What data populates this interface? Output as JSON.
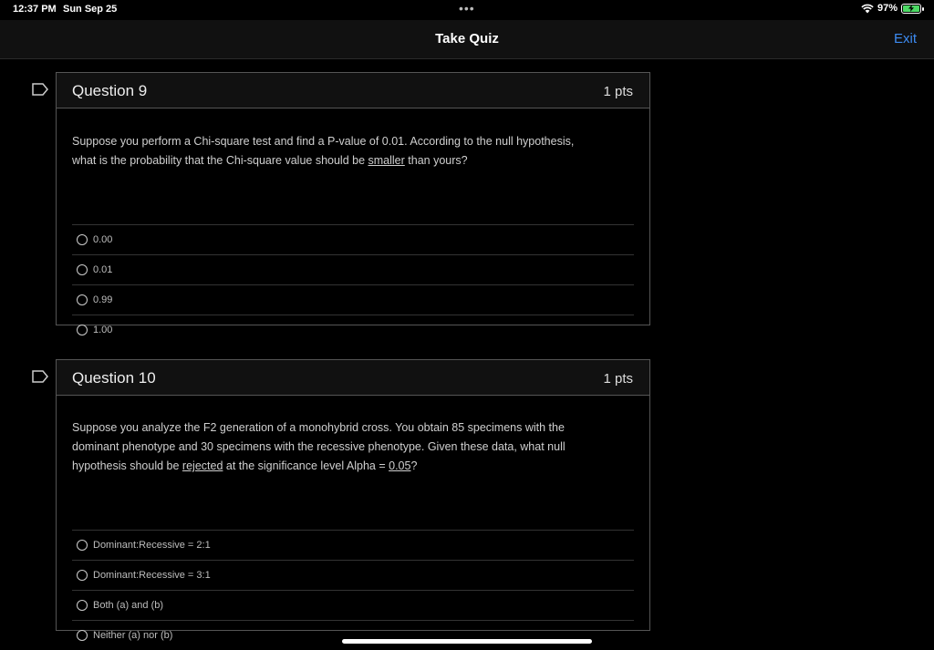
{
  "status": {
    "time": "12:37 PM",
    "date": "Sun Sep 25",
    "dots": "•••",
    "battery": "97%"
  },
  "nav": {
    "title": "Take Quiz",
    "exit_label": "Exit"
  },
  "questions": [
    {
      "title": "Question 9",
      "points": "1 pts",
      "text_parts": {
        "a": "Suppose you perform a Chi-square test and find a P-value of 0.01. According to the null hypothesis,",
        "b": "what is the probability that the Chi-square value should be ",
        "u1": "smaller",
        "c": " than yours?"
      },
      "answers": [
        "0.00",
        "0.01",
        "0.99",
        "1.00"
      ]
    },
    {
      "title": "Question 10",
      "points": "1 pts",
      "text_parts": {
        "a": "Suppose you analyze the F2 generation of a monohybrid cross. You obtain 85 specimens with the",
        "b": "dominant phenotype and 30 specimens with the recessive phenotype. Given these data, what null",
        "c": "hypothesis should be ",
        "u1": "rejected",
        "d": " at the significance level Alpha = ",
        "u2": "0.05",
        "e": "?"
      },
      "answers": [
        "Dominant:Recessive = 2:1",
        "Dominant:Recessive = 3:1",
        "Both (a) and (b)",
        "Neither (a) nor (b)"
      ]
    }
  ],
  "icons": {
    "bookmark": "bookmark-icon",
    "wifi": "wifi-icon",
    "battery": "battery-icon"
  },
  "colors": {
    "accent": "#3d8bf2",
    "battery": "#4cd964"
  }
}
